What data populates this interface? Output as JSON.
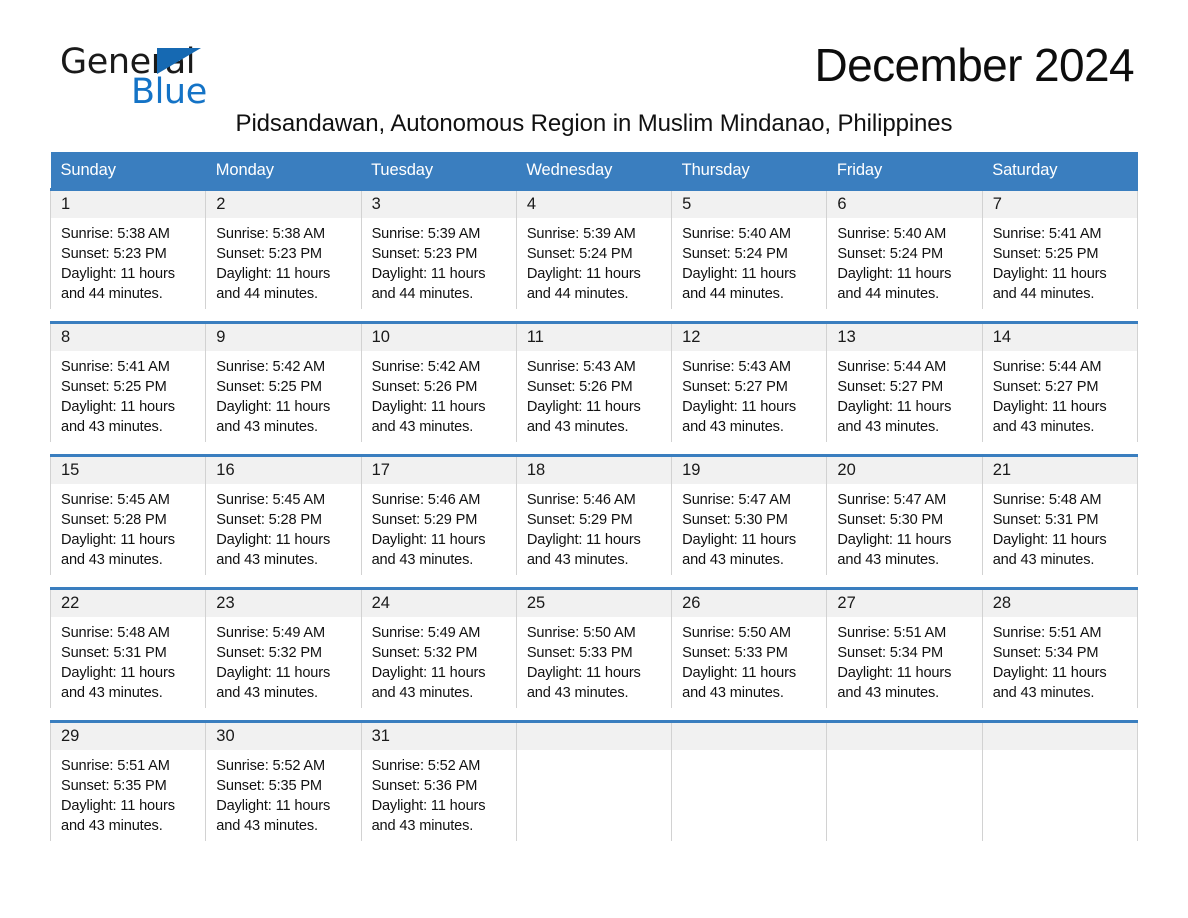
{
  "brand": {
    "name_part1": "General",
    "name_part2": "Blue",
    "accent_color": "#1473c6"
  },
  "header": {
    "month_title": "December 2024",
    "location": "Pidsandawan, Autonomous Region in Muslim Mindanao, Philippines",
    "header_bg_color": "#3a7ebf"
  },
  "calendar": {
    "weekday_headers": [
      "Sunday",
      "Monday",
      "Tuesday",
      "Wednesday",
      "Thursday",
      "Friday",
      "Saturday"
    ],
    "weeks": [
      [
        {
          "day": "1",
          "sunrise": "Sunrise: 5:38 AM",
          "sunset": "Sunset: 5:23 PM",
          "daylight": "Daylight: 11 hours and 44 minutes."
        },
        {
          "day": "2",
          "sunrise": "Sunrise: 5:38 AM",
          "sunset": "Sunset: 5:23 PM",
          "daylight": "Daylight: 11 hours and 44 minutes."
        },
        {
          "day": "3",
          "sunrise": "Sunrise: 5:39 AM",
          "sunset": "Sunset: 5:23 PM",
          "daylight": "Daylight: 11 hours and 44 minutes."
        },
        {
          "day": "4",
          "sunrise": "Sunrise: 5:39 AM",
          "sunset": "Sunset: 5:24 PM",
          "daylight": "Daylight: 11 hours and 44 minutes."
        },
        {
          "day": "5",
          "sunrise": "Sunrise: 5:40 AM",
          "sunset": "Sunset: 5:24 PM",
          "daylight": "Daylight: 11 hours and 44 minutes."
        },
        {
          "day": "6",
          "sunrise": "Sunrise: 5:40 AM",
          "sunset": "Sunset: 5:24 PM",
          "daylight": "Daylight: 11 hours and 44 minutes."
        },
        {
          "day": "7",
          "sunrise": "Sunrise: 5:41 AM",
          "sunset": "Sunset: 5:25 PM",
          "daylight": "Daylight: 11 hours and 44 minutes."
        }
      ],
      [
        {
          "day": "8",
          "sunrise": "Sunrise: 5:41 AM",
          "sunset": "Sunset: 5:25 PM",
          "daylight": "Daylight: 11 hours and 43 minutes."
        },
        {
          "day": "9",
          "sunrise": "Sunrise: 5:42 AM",
          "sunset": "Sunset: 5:25 PM",
          "daylight": "Daylight: 11 hours and 43 minutes."
        },
        {
          "day": "10",
          "sunrise": "Sunrise: 5:42 AM",
          "sunset": "Sunset: 5:26 PM",
          "daylight": "Daylight: 11 hours and 43 minutes."
        },
        {
          "day": "11",
          "sunrise": "Sunrise: 5:43 AM",
          "sunset": "Sunset: 5:26 PM",
          "daylight": "Daylight: 11 hours and 43 minutes."
        },
        {
          "day": "12",
          "sunrise": "Sunrise: 5:43 AM",
          "sunset": "Sunset: 5:27 PM",
          "daylight": "Daylight: 11 hours and 43 minutes."
        },
        {
          "day": "13",
          "sunrise": "Sunrise: 5:44 AM",
          "sunset": "Sunset: 5:27 PM",
          "daylight": "Daylight: 11 hours and 43 minutes."
        },
        {
          "day": "14",
          "sunrise": "Sunrise: 5:44 AM",
          "sunset": "Sunset: 5:27 PM",
          "daylight": "Daylight: 11 hours and 43 minutes."
        }
      ],
      [
        {
          "day": "15",
          "sunrise": "Sunrise: 5:45 AM",
          "sunset": "Sunset: 5:28 PM",
          "daylight": "Daylight: 11 hours and 43 minutes."
        },
        {
          "day": "16",
          "sunrise": "Sunrise: 5:45 AM",
          "sunset": "Sunset: 5:28 PM",
          "daylight": "Daylight: 11 hours and 43 minutes."
        },
        {
          "day": "17",
          "sunrise": "Sunrise: 5:46 AM",
          "sunset": "Sunset: 5:29 PM",
          "daylight": "Daylight: 11 hours and 43 minutes."
        },
        {
          "day": "18",
          "sunrise": "Sunrise: 5:46 AM",
          "sunset": "Sunset: 5:29 PM",
          "daylight": "Daylight: 11 hours and 43 minutes."
        },
        {
          "day": "19",
          "sunrise": "Sunrise: 5:47 AM",
          "sunset": "Sunset: 5:30 PM",
          "daylight": "Daylight: 11 hours and 43 minutes."
        },
        {
          "day": "20",
          "sunrise": "Sunrise: 5:47 AM",
          "sunset": "Sunset: 5:30 PM",
          "daylight": "Daylight: 11 hours and 43 minutes."
        },
        {
          "day": "21",
          "sunrise": "Sunrise: 5:48 AM",
          "sunset": "Sunset: 5:31 PM",
          "daylight": "Daylight: 11 hours and 43 minutes."
        }
      ],
      [
        {
          "day": "22",
          "sunrise": "Sunrise: 5:48 AM",
          "sunset": "Sunset: 5:31 PM",
          "daylight": "Daylight: 11 hours and 43 minutes."
        },
        {
          "day": "23",
          "sunrise": "Sunrise: 5:49 AM",
          "sunset": "Sunset: 5:32 PM",
          "daylight": "Daylight: 11 hours and 43 minutes."
        },
        {
          "day": "24",
          "sunrise": "Sunrise: 5:49 AM",
          "sunset": "Sunset: 5:32 PM",
          "daylight": "Daylight: 11 hours and 43 minutes."
        },
        {
          "day": "25",
          "sunrise": "Sunrise: 5:50 AM",
          "sunset": "Sunset: 5:33 PM",
          "daylight": "Daylight: 11 hours and 43 minutes."
        },
        {
          "day": "26",
          "sunrise": "Sunrise: 5:50 AM",
          "sunset": "Sunset: 5:33 PM",
          "daylight": "Daylight: 11 hours and 43 minutes."
        },
        {
          "day": "27",
          "sunrise": "Sunrise: 5:51 AM",
          "sunset": "Sunset: 5:34 PM",
          "daylight": "Daylight: 11 hours and 43 minutes."
        },
        {
          "day": "28",
          "sunrise": "Sunrise: 5:51 AM",
          "sunset": "Sunset: 5:34 PM",
          "daylight": "Daylight: 11 hours and 43 minutes."
        }
      ],
      [
        {
          "day": "29",
          "sunrise": "Sunrise: 5:51 AM",
          "sunset": "Sunset: 5:35 PM",
          "daylight": "Daylight: 11 hours and 43 minutes."
        },
        {
          "day": "30",
          "sunrise": "Sunrise: 5:52 AM",
          "sunset": "Sunset: 5:35 PM",
          "daylight": "Daylight: 11 hours and 43 minutes."
        },
        {
          "day": "31",
          "sunrise": "Sunrise: 5:52 AM",
          "sunset": "Sunset: 5:36 PM",
          "daylight": "Daylight: 11 hours and 43 minutes."
        },
        {
          "day": "",
          "sunrise": "",
          "sunset": "",
          "daylight": ""
        },
        {
          "day": "",
          "sunrise": "",
          "sunset": "",
          "daylight": ""
        },
        {
          "day": "",
          "sunrise": "",
          "sunset": "",
          "daylight": ""
        },
        {
          "day": "",
          "sunrise": "",
          "sunset": "",
          "daylight": ""
        }
      ]
    ]
  }
}
